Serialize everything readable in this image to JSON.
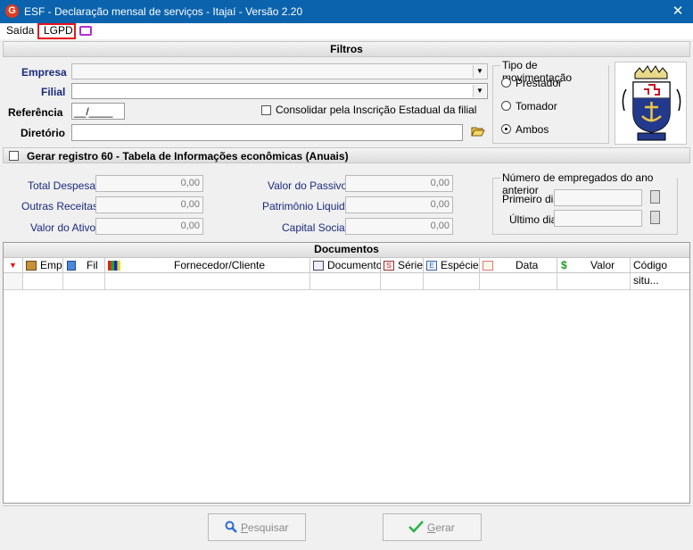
{
  "window": {
    "title": "ESF - Declaração mensal de serviços - Itajaí - Versão 2.20",
    "close": "✕",
    "app_icon": "G"
  },
  "menu": {
    "items": [
      "Saída",
      "LGPD"
    ]
  },
  "filters": {
    "header": "Filtros",
    "empresa_label": "Empresa",
    "filial_label": "Filial",
    "referencia_label": "Referência",
    "referencia_value": "__/____",
    "diretorio_label": "Diretório",
    "consolidar_label": "Consolidar pela Inscrição Estadual da filial",
    "tipo": {
      "caption": "Tipo de movimentação",
      "options": [
        "Prestador",
        "Tomador",
        "Ambos"
      ],
      "selected": "Ambos"
    }
  },
  "registro60": {
    "label": "Gerar registro 60 - Tabela de Informações econômicas (Anuais)",
    "fields": {
      "total_despesa": {
        "label": "Total Despesa",
        "value": "0,00"
      },
      "outras_receitas": {
        "label": "Outras Receitas",
        "value": "0,00"
      },
      "valor_ativo": {
        "label": "Valor do Ativo",
        "value": "0,00"
      },
      "valor_passivo": {
        "label": "Valor do Passivo",
        "value": "0,00"
      },
      "patrimonio_liquido": {
        "label": "Patrimônio Liquido",
        "value": "0,00"
      },
      "capital_social": {
        "label": "Capital Social",
        "value": "0,00"
      }
    },
    "empregados": {
      "caption": "Número de empregados do ano anterior",
      "primeiro_label": "Primeiro dia",
      "ultimo_label": "Último dia"
    }
  },
  "documents": {
    "header": "Documentos",
    "columns": [
      "Emp",
      "Fil",
      "Fornecedor/Cliente",
      "Documento",
      "Série",
      "Espécie",
      "Data",
      "Valor",
      "Código situ..."
    ]
  },
  "buttons": {
    "pesquisar_first": "P",
    "pesquisar_rest": "esquisar",
    "gerar_first": "G",
    "gerar_rest": "erar"
  },
  "colors": {
    "titlebar": "#0b63ad",
    "label_blue": "#1b2a7e",
    "highlight_red": "#e8141a"
  }
}
